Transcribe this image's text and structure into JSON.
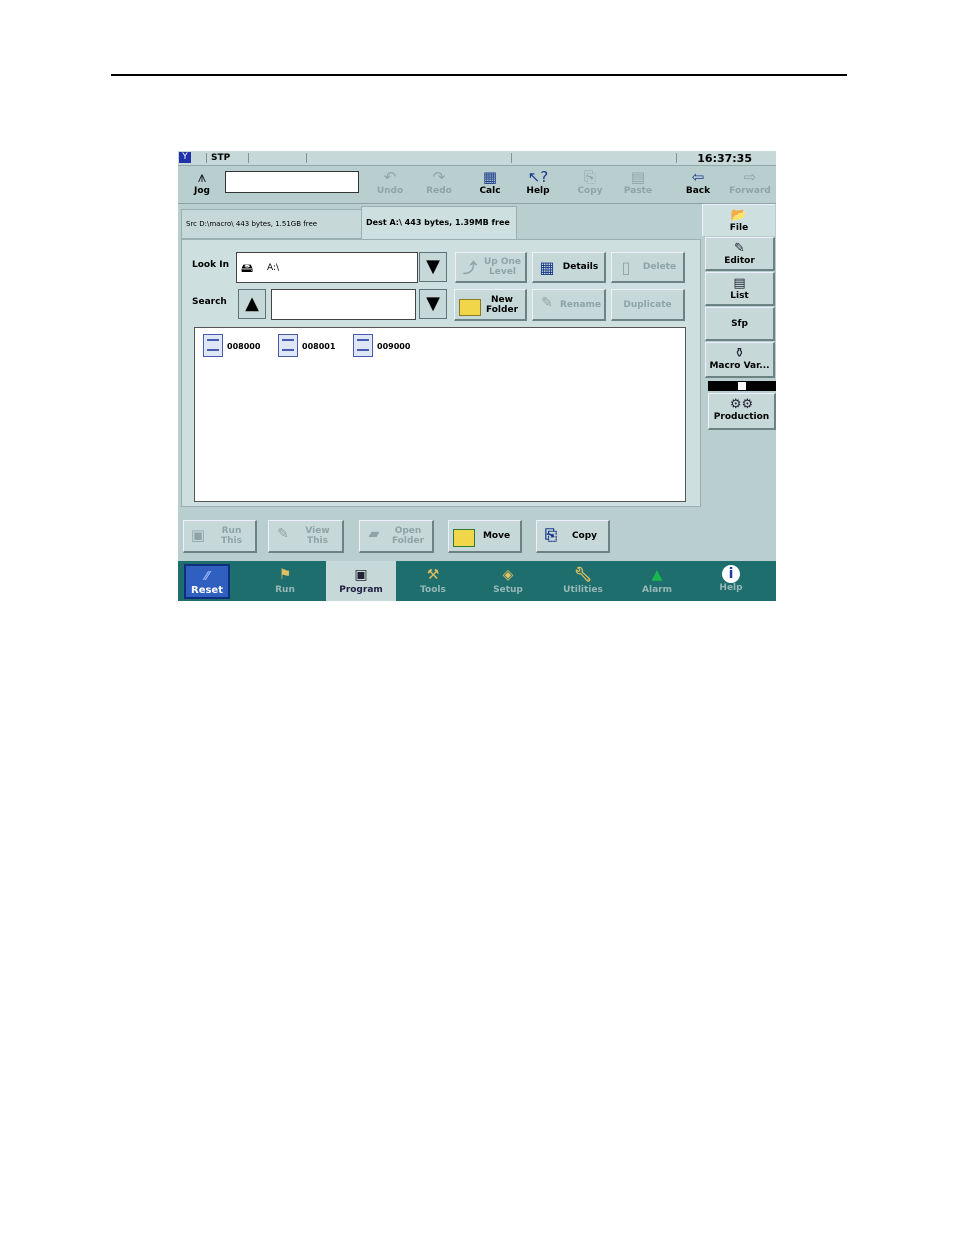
{
  "status": {
    "logo": "Y",
    "mode": "STP",
    "time": "16:37:35"
  },
  "toolbar": {
    "jog": "Jog",
    "undo": "Undo",
    "redo": "Redo",
    "calc": "Calc",
    "help": "Help",
    "copy": "Copy",
    "paste": "Paste",
    "back": "Back",
    "forward": "Forward"
  },
  "tabs": {
    "src": "Src D:\\macro\\   443 bytes, 1.51GB free",
    "dest": "Dest A:\\    443 bytes, 1.39MB free"
  },
  "form": {
    "look_in_label": "Look In",
    "look_in_value": "A:\\",
    "search_label": "Search",
    "search_value": ""
  },
  "buttons": {
    "up_one_level": "Up One Level",
    "details": "Details",
    "delete": "Delete",
    "new_folder": "New Folder",
    "rename": "Rename",
    "duplicate": "Duplicate",
    "run_this": "Run This",
    "view_this": "View This",
    "open_folder": "Open Folder",
    "move": "Move",
    "copy": "Copy"
  },
  "files": [
    "008000",
    "008001",
    "009000"
  ],
  "side_tabs": {
    "file": "File",
    "editor": "Editor",
    "list": "List",
    "sfp": "Sfp",
    "macro_var": "Macro Var...",
    "production": "Production"
  },
  "nav": {
    "reset": "Reset",
    "run": "Run",
    "program": "Program",
    "tools": "Tools",
    "setup": "Setup",
    "utilities": "Utilities",
    "alarm": "Alarm",
    "help": "Help"
  },
  "icons": [
    "jog-icon",
    "undo-icon",
    "redo-icon",
    "calc-icon",
    "help-cursor-icon",
    "copy-icon",
    "paste-icon",
    "back-arrow-icon",
    "forward-arrow-icon",
    "drive-icon",
    "up-folder-icon",
    "details-grid-icon",
    "delete-icon",
    "new-folder-icon",
    "rename-icon",
    "run-icon",
    "view-icon",
    "open-folder-icon",
    "move-icon",
    "file-icon"
  ]
}
